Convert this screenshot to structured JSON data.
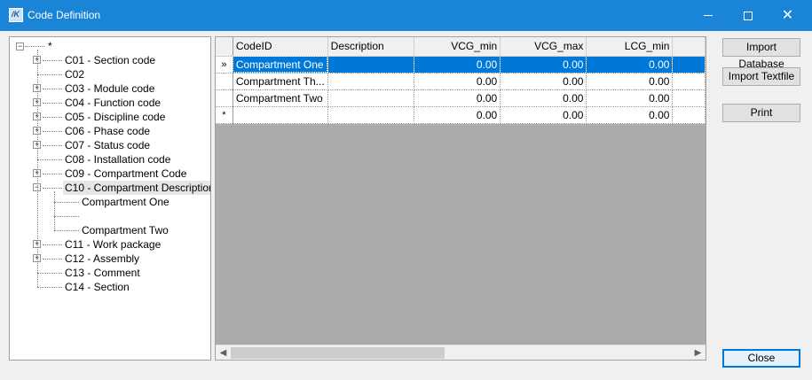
{
  "window": {
    "title": "Code Definition",
    "app_icon": "ship-logo-icon"
  },
  "tree": {
    "root_label": "*",
    "items": [
      {
        "label": "C01 - Section code",
        "expander": "+"
      },
      {
        "label": "C02",
        "expander": ""
      },
      {
        "label": "C03 - Module code",
        "expander": "+"
      },
      {
        "label": "C04 - Function code",
        "expander": "+"
      },
      {
        "label": "C05 - Discipline code",
        "expander": "+"
      },
      {
        "label": "C06 - Phase code",
        "expander": "+"
      },
      {
        "label": "C07 - Status code",
        "expander": "+"
      },
      {
        "label": "C08 - Installation code",
        "expander": ""
      },
      {
        "label": "C09 - Compartment Code",
        "expander": "+"
      },
      {
        "label": "C10 - Compartment Description",
        "expander": "-"
      },
      {
        "label": "C11 - Work package",
        "expander": "+"
      },
      {
        "label": "C12 - Assembly",
        "expander": "+"
      },
      {
        "label": "C13 - Comment",
        "expander": ""
      },
      {
        "label": "C14 - Section",
        "expander": ""
      }
    ],
    "c10_children": [
      "Compartment One",
      "",
      "Compartment Two"
    ]
  },
  "grid": {
    "columns": [
      "CodeID",
      "Description",
      "VCG_min",
      "VCG_max",
      "LCG_min"
    ],
    "rows": [
      {
        "marker": "»",
        "CodeID": "Compartment One",
        "Description": "",
        "VCG_min": "0.00",
        "VCG_max": "0.00",
        "LCG_min": "0.00"
      },
      {
        "marker": "",
        "CodeID": "Compartment Th...",
        "Description": "",
        "VCG_min": "0.00",
        "VCG_max": "0.00",
        "LCG_min": "0.00"
      },
      {
        "marker": "",
        "CodeID": "Compartment Two",
        "Description": "",
        "VCG_min": "0.00",
        "VCG_max": "0.00",
        "LCG_min": "0.00"
      },
      {
        "marker": "*",
        "CodeID": "",
        "Description": "",
        "VCG_min": "0.00",
        "VCG_max": "0.00",
        "LCG_min": "0.00"
      }
    ]
  },
  "buttons": {
    "import_database": "Import Database",
    "import_textfile": "Import Textfile",
    "print": "Print",
    "close": "Close"
  },
  "colors": {
    "titlebar": "#1a84d6",
    "selection": "#0078d7"
  }
}
